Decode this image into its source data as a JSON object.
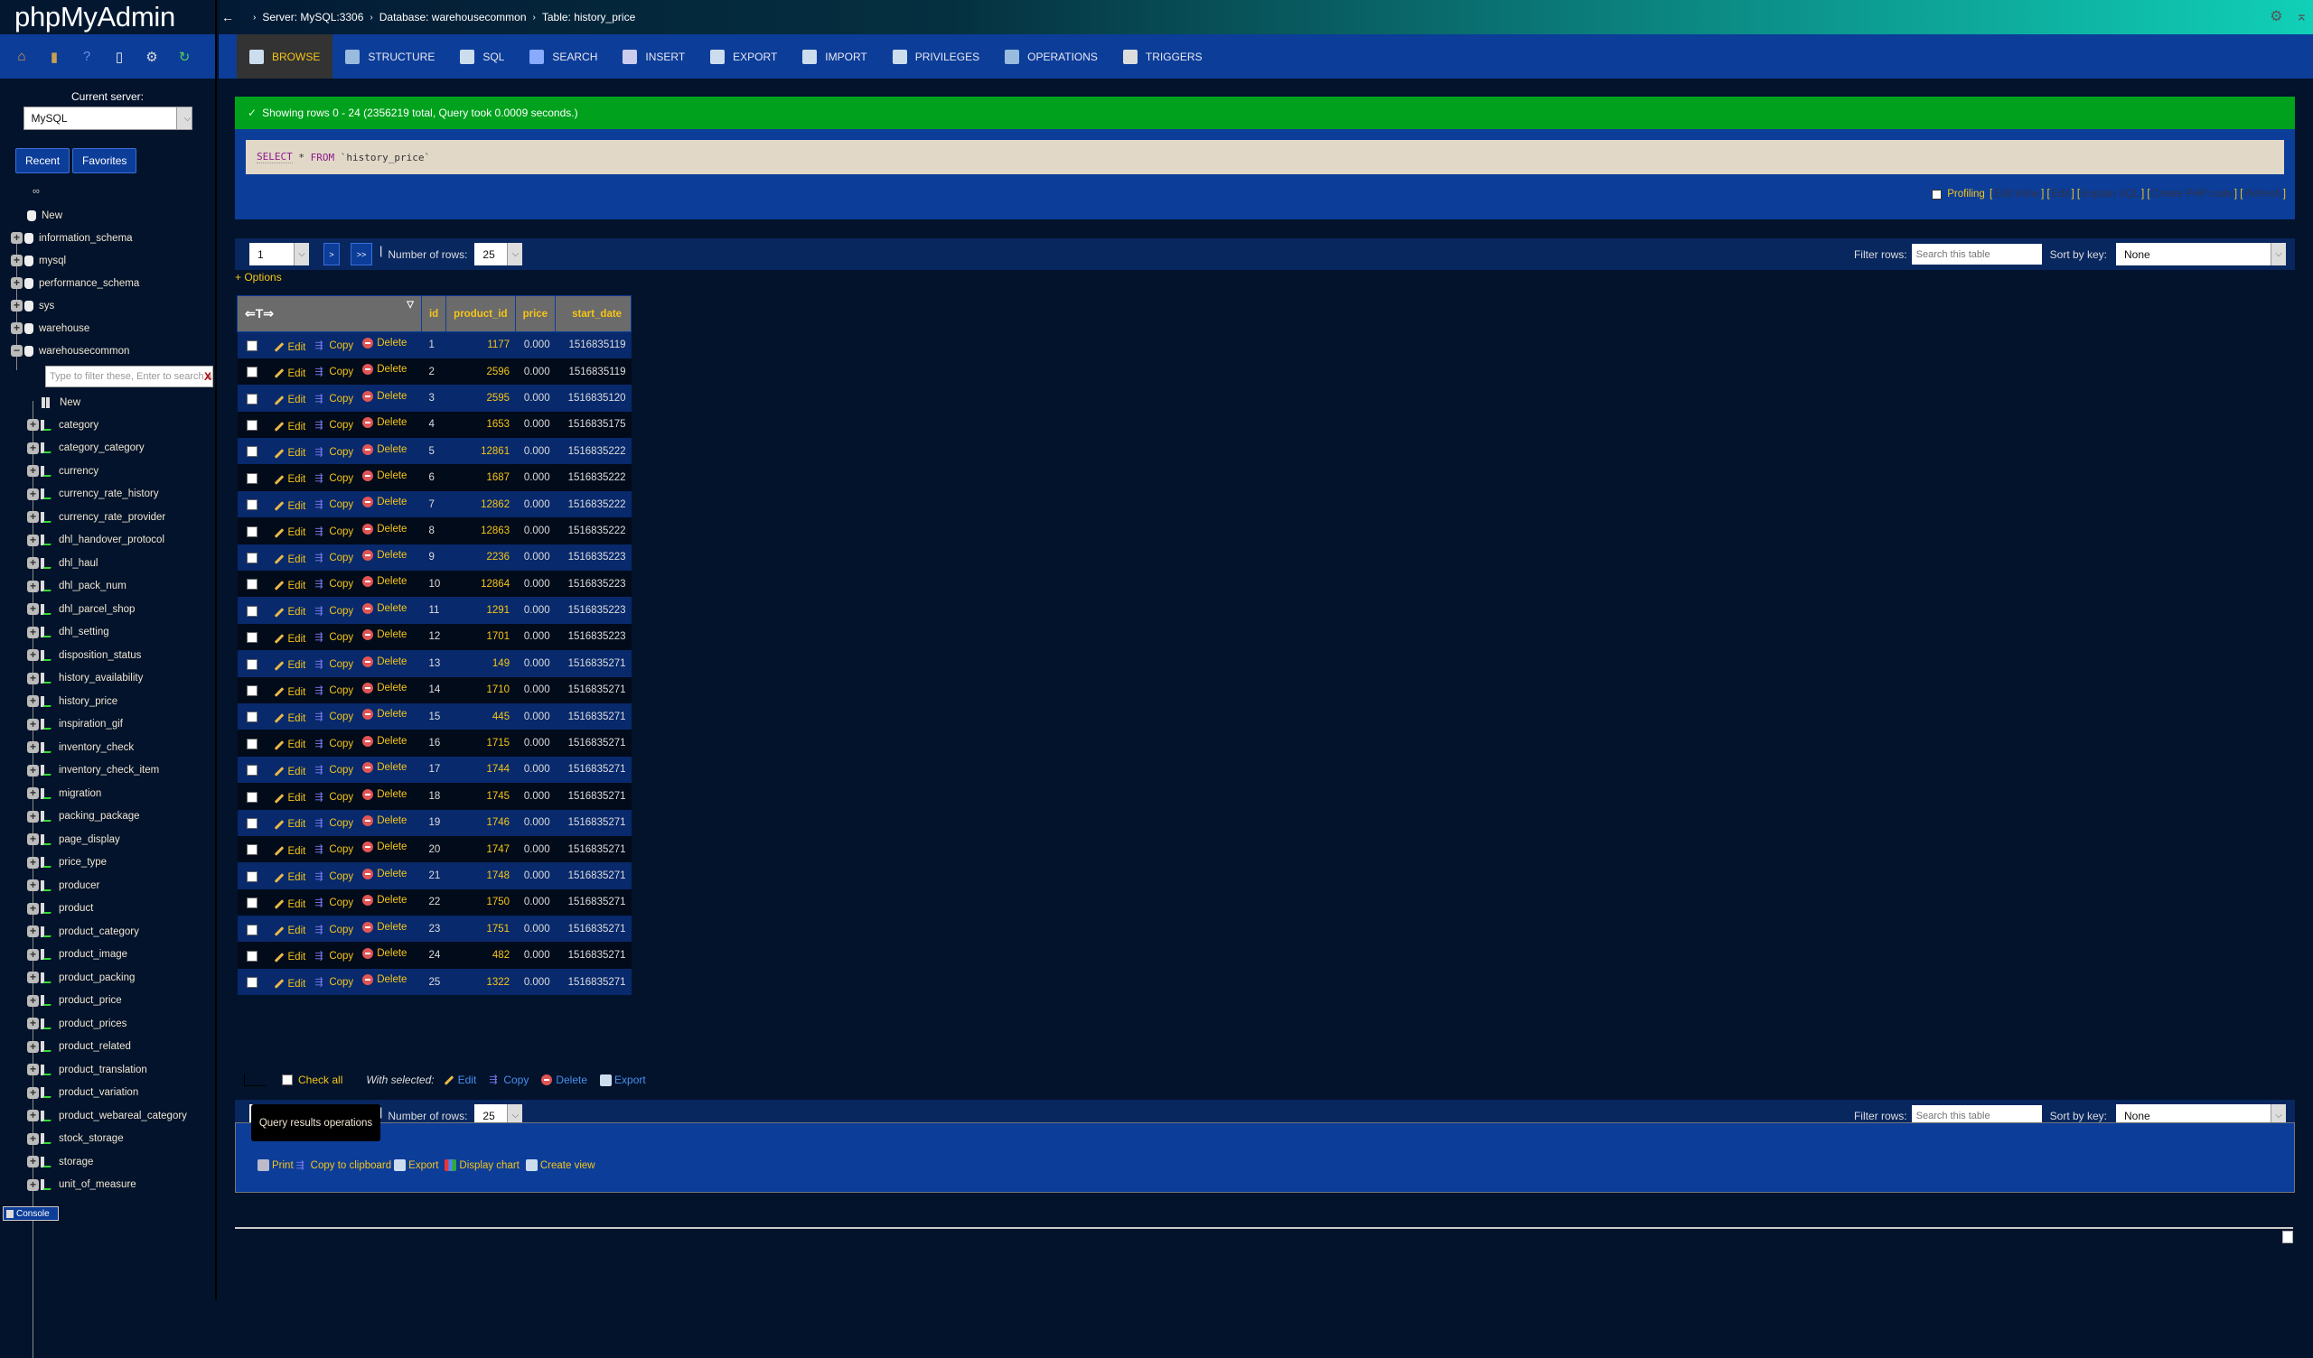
{
  "app": {
    "logo": "phpMyAdmin"
  },
  "breadcrumb": {
    "back_icon": "left-arrow",
    "server": "Server: MySQL:3306",
    "database": "Database: warehousecommon",
    "table": "Table: history_price"
  },
  "topbar_icons": [
    "gear-icon",
    "collapse-top-icon"
  ],
  "sidebar": {
    "icons": [
      "home-icon",
      "logout-icon",
      "help-icon",
      "docs-icon",
      "settings-icon",
      "reload-icon"
    ],
    "current_server_label": "Current server:",
    "current_server_value": "MySQL",
    "tabs": [
      "Recent",
      "Favorites"
    ],
    "new_db_label": "New",
    "databases": [
      "information_schema",
      "mysql",
      "performance_schema",
      "sys",
      "warehouse",
      "warehousecommon"
    ],
    "table_filter_placeholder": "Type to filter these, Enter to search a",
    "table_filter_clear": "X",
    "new_table_label": "New",
    "tables": [
      "category",
      "category_category",
      "currency",
      "currency_rate_history",
      "currency_rate_provider",
      "dhl_handover_protocol",
      "dhl_haul",
      "dhl_pack_num",
      "dhl_parcel_shop",
      "dhl_setting",
      "disposition_status",
      "history_availability",
      "history_price",
      "inspiration_gif",
      "inventory_check",
      "inventory_check_item",
      "migration",
      "packing_package",
      "page_display",
      "price_type",
      "producer",
      "product",
      "product_category",
      "product_image",
      "product_packing",
      "product_price",
      "product_prices",
      "product_related",
      "product_translation",
      "product_variation",
      "product_webareal_category",
      "stock_storage",
      "storage",
      "unit_of_measure"
    ]
  },
  "tabs": [
    {
      "label": "BROWSE",
      "icon": "browse-icon",
      "active": true
    },
    {
      "label": "STRUCTURE",
      "icon": "structure-icon"
    },
    {
      "label": "SQL",
      "icon": "sql-icon"
    },
    {
      "label": "SEARCH",
      "icon": "search-icon"
    },
    {
      "label": "INSERT",
      "icon": "insert-icon"
    },
    {
      "label": "EXPORT",
      "icon": "export-icon"
    },
    {
      "label": "IMPORT",
      "icon": "import-icon"
    },
    {
      "label": "PRIVILEGES",
      "icon": "privileges-icon"
    },
    {
      "label": "OPERATIONS",
      "icon": "operations-icon"
    },
    {
      "label": "TRIGGERS",
      "icon": "triggers-icon"
    }
  ],
  "success_message": "Showing rows 0 - 24 (2356219 total, Query took 0.0009 seconds.)",
  "sql": {
    "keyword1": "SELECT",
    "star": " * ",
    "keyword2": "FROM",
    "identifier": " `history_price`"
  },
  "sql_links": {
    "profiling": "Profiling",
    "edit_inline": "Edit inline",
    "edit": "Edit",
    "explain": "Explain SQL",
    "php": "Create PHP code",
    "refresh": "Refresh"
  },
  "navigation": {
    "page": "1",
    "next": ">",
    "last": ">>",
    "rows_label": "Number of rows:",
    "rows_value": "25",
    "filter_label": "Filter rows:",
    "filter_placeholder": "Search this table",
    "sort_label": "Sort by key:",
    "sort_value": "None"
  },
  "options_link": "+ Options",
  "table": {
    "columns": [
      "id",
      "product_id",
      "price",
      "start_date"
    ],
    "actions": {
      "edit": "Edit",
      "copy": "Copy",
      "delete": "Delete"
    },
    "rows": [
      [
        1,
        1177,
        "0.000",
        1516835119
      ],
      [
        2,
        2596,
        "0.000",
        1516835119
      ],
      [
        3,
        2595,
        "0.000",
        1516835120
      ],
      [
        4,
        1653,
        "0.000",
        1516835175
      ],
      [
        5,
        12861,
        "0.000",
        1516835222
      ],
      [
        6,
        1687,
        "0.000",
        1516835222
      ],
      [
        7,
        12862,
        "0.000",
        1516835222
      ],
      [
        8,
        12863,
        "0.000",
        1516835222
      ],
      [
        9,
        2236,
        "0.000",
        1516835223
      ],
      [
        10,
        12864,
        "0.000",
        1516835223
      ],
      [
        11,
        1291,
        "0.000",
        1516835223
      ],
      [
        12,
        1701,
        "0.000",
        1516835223
      ],
      [
        13,
        149,
        "0.000",
        1516835271
      ],
      [
        14,
        1710,
        "0.000",
        1516835271
      ],
      [
        15,
        445,
        "0.000",
        1516835271
      ],
      [
        16,
        1715,
        "0.000",
        1516835271
      ],
      [
        17,
        1744,
        "0.000",
        1516835271
      ],
      [
        18,
        1745,
        "0.000",
        1516835271
      ],
      [
        19,
        1746,
        "0.000",
        1516835271
      ],
      [
        20,
        1747,
        "0.000",
        1516835271
      ],
      [
        21,
        1748,
        "0.000",
        1516835271
      ],
      [
        22,
        1750,
        "0.000",
        1516835271
      ],
      [
        23,
        1751,
        "0.000",
        1516835271
      ],
      [
        24,
        482,
        "0.000",
        1516835271
      ],
      [
        25,
        1322,
        "0.000",
        1516835271
      ]
    ]
  },
  "bulk": {
    "check_all": "Check all",
    "with_selected": "With selected:",
    "edit": "Edit",
    "copy": "Copy",
    "delete": "Delete",
    "export": "Export"
  },
  "query_ops": {
    "title": "Query results operations",
    "print": "Print",
    "copy_clipboard": "Copy to clipboard",
    "export": "Export",
    "display_chart": "Display chart",
    "create_view": "Create view"
  },
  "console_label": "Console",
  "colors": {
    "accent_yellow": "#f5c518",
    "nav_blue": "#0c3d99",
    "success_green": "#00a21d",
    "bg": "#02132b"
  }
}
